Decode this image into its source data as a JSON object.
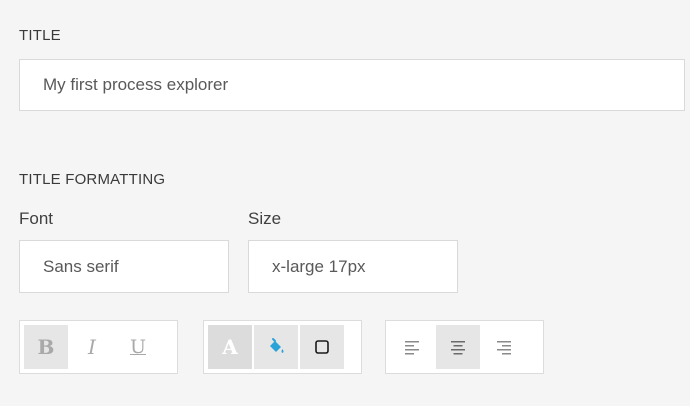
{
  "title_section": {
    "label": "TITLE",
    "value": "My first process explorer"
  },
  "formatting_section": {
    "label": "TITLE FORMATTING",
    "font_label": "Font",
    "font_value": "Sans serif",
    "size_label": "Size",
    "size_value": "x-large 17px"
  },
  "toolbar": {
    "bold": "B",
    "italic": "I",
    "underline": "U",
    "text_color": "A",
    "fill_color_hex": "#2aa3d8"
  }
}
